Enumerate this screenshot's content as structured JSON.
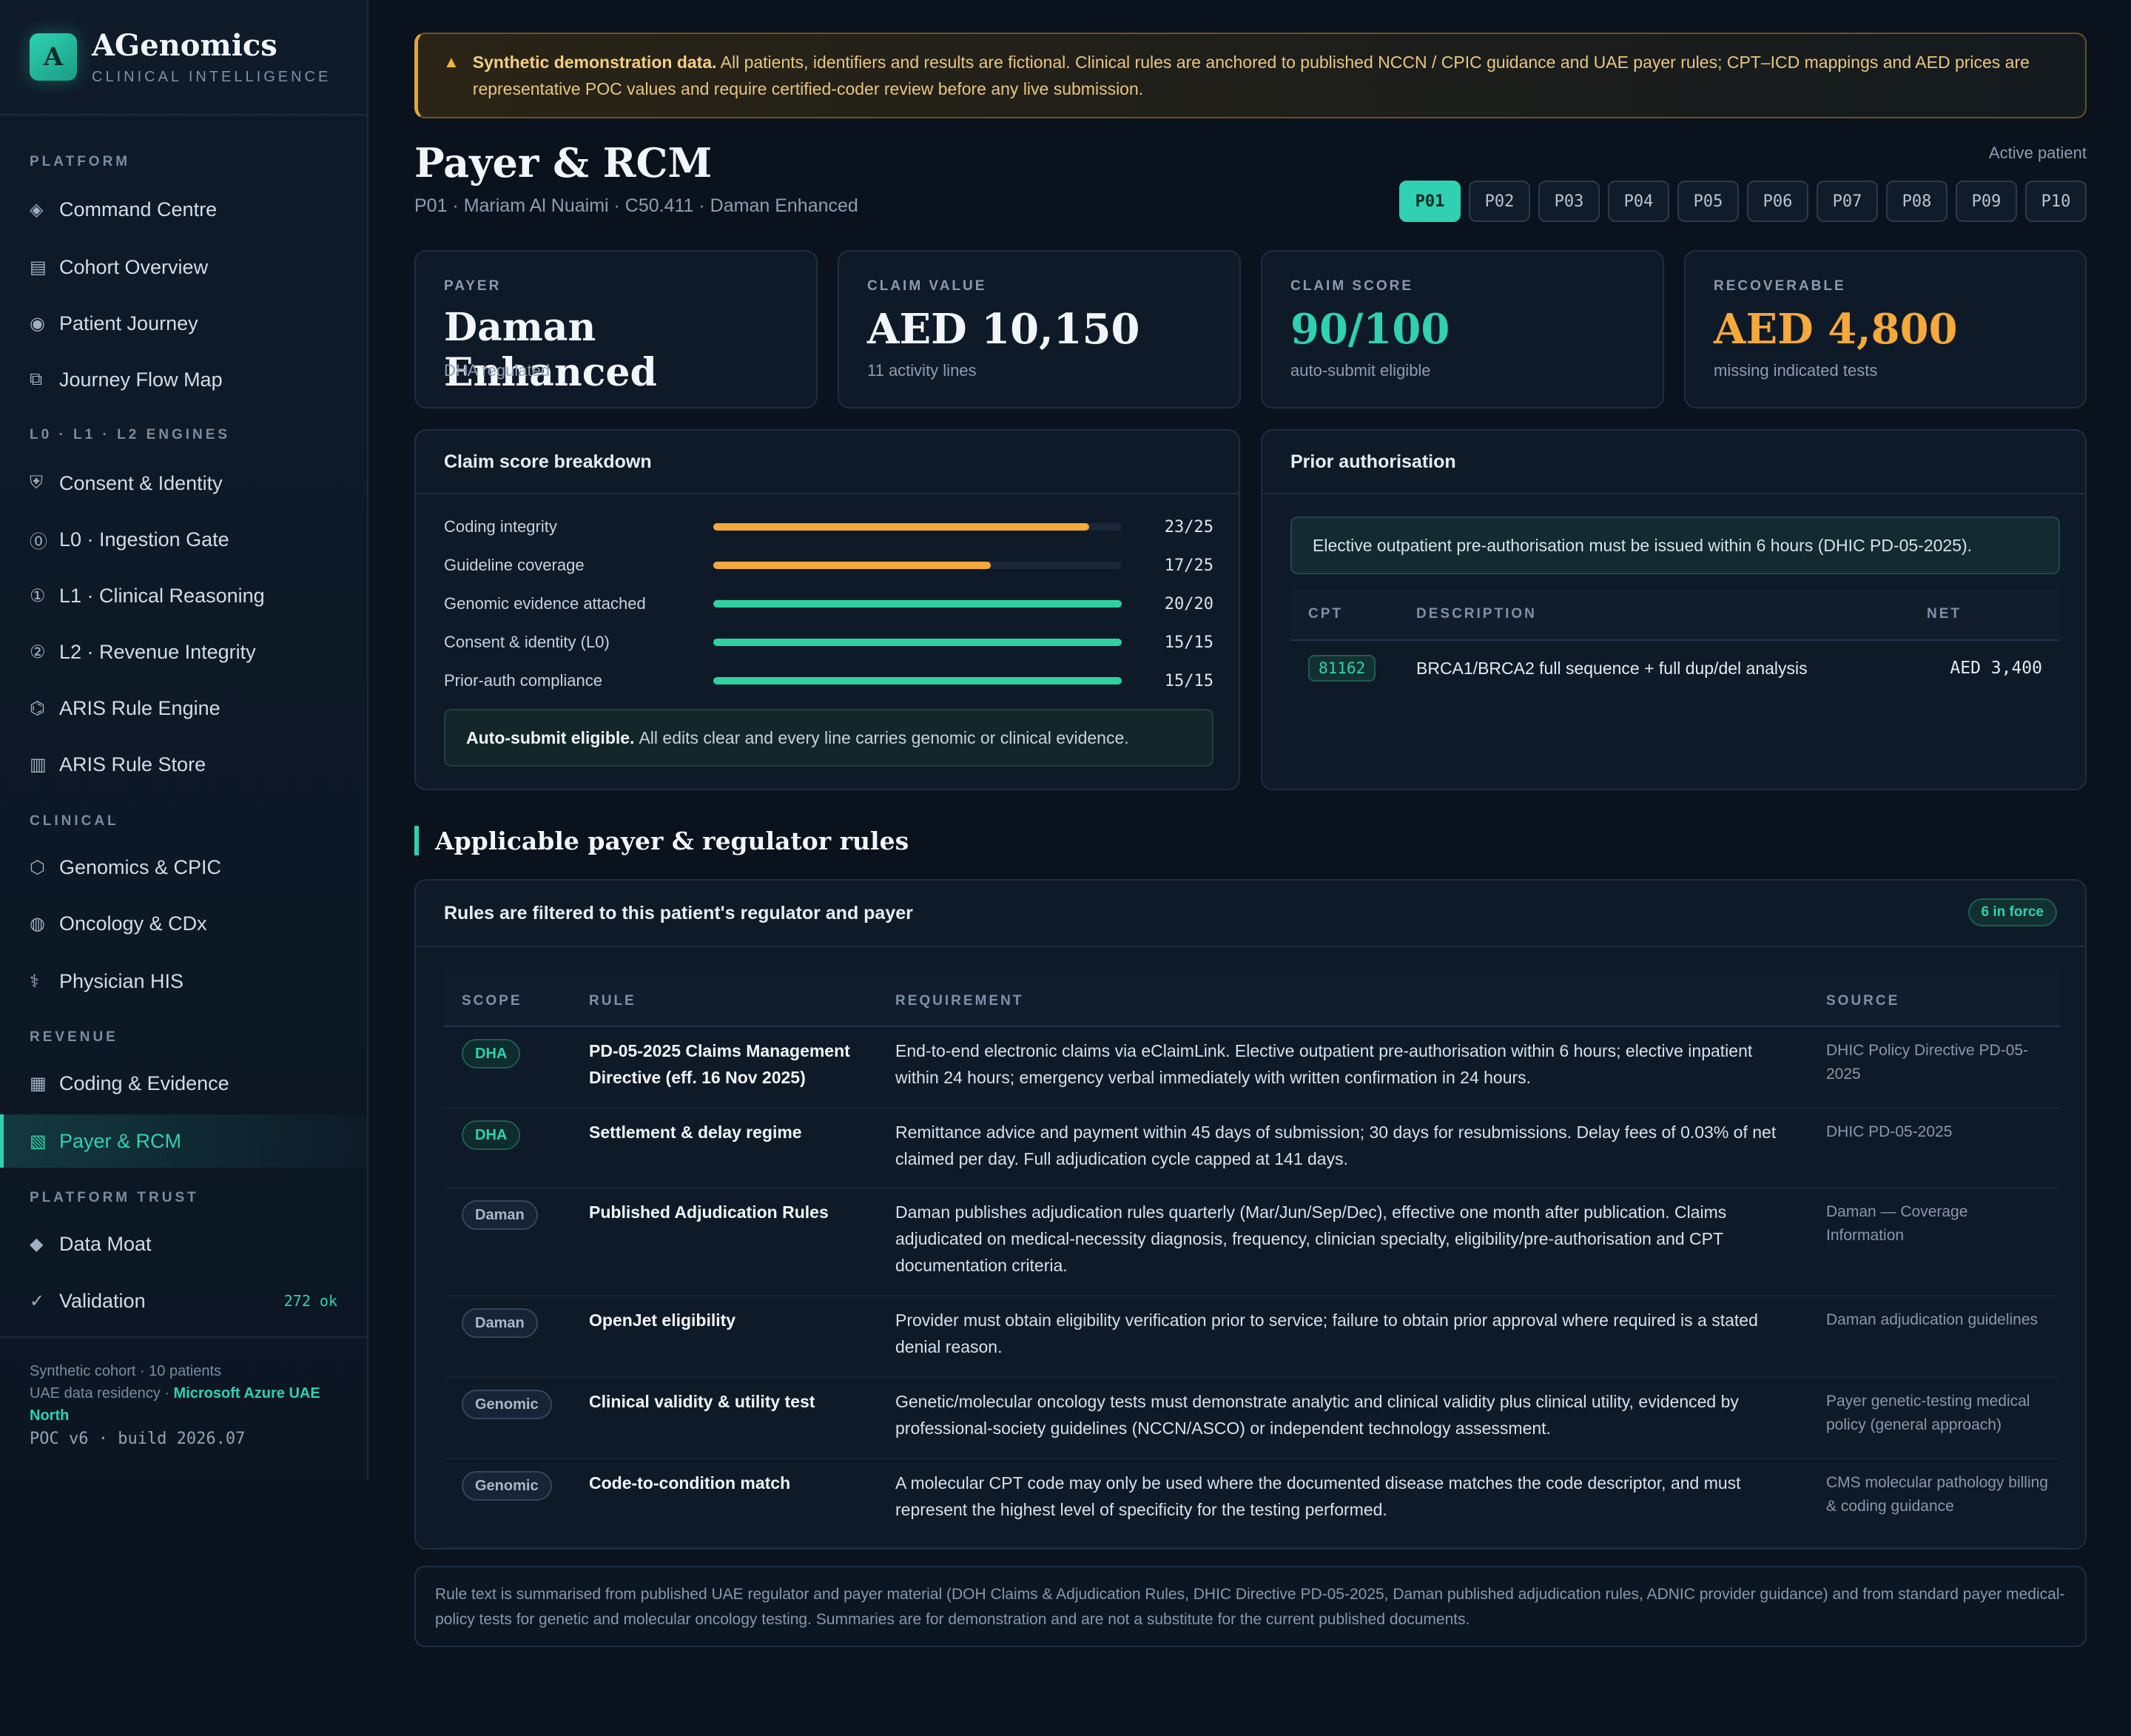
{
  "brand": {
    "logo_letter": "A",
    "name": "AGenomics",
    "subtitle": "CLINICAL INTELLIGENCE"
  },
  "sidebar": {
    "sections": {
      "platform": "PLATFORM",
      "engines": "L0 · L1 · L2 ENGINES",
      "clinical": "CLINICAL",
      "revenue": "REVENUE",
      "trust": "PLATFORM TRUST"
    },
    "items": [
      {
        "label": "Command Centre",
        "icon": "◈"
      },
      {
        "label": "Cohort Overview",
        "icon": "▤"
      },
      {
        "label": "Patient Journey",
        "icon": "◉"
      },
      {
        "label": "Journey Flow Map",
        "icon": "⧉"
      },
      {
        "label": "Consent & Identity",
        "icon": "⛨"
      },
      {
        "label": "L0 · Ingestion Gate",
        "icon": "⓪"
      },
      {
        "label": "L1 · Clinical Reasoning",
        "icon": "①"
      },
      {
        "label": "L2 · Revenue Integrity",
        "icon": "②"
      },
      {
        "label": "ARIS Rule Engine",
        "icon": "⌬"
      },
      {
        "label": "ARIS Rule Store",
        "icon": "▥"
      },
      {
        "label": "Genomics & CPIC",
        "icon": "⬡"
      },
      {
        "label": "Oncology & CDx",
        "icon": "◍"
      },
      {
        "label": "Physician HIS",
        "icon": "⚕"
      },
      {
        "label": "Coding & Evidence",
        "icon": "▦"
      },
      {
        "label": "Payer & RCM",
        "icon": "▧"
      },
      {
        "label": "Data Moat",
        "icon": "◆"
      },
      {
        "label": "Validation",
        "icon": "✓",
        "badge": "272 ok"
      }
    ],
    "footer": {
      "line1": "Synthetic cohort · 10 patients",
      "line2_prefix": "UAE data residency · ",
      "line2_highlight_a": "Microsoft Azure UAE",
      "line2_highlight_b": "North",
      "build": "POC v6 · build 2026.07"
    }
  },
  "banner": {
    "icon": "▲",
    "bold": "Synthetic demonstration data.",
    "text": "All patients, identifiers and results are fictional. Clinical rules are anchored to published NCCN / CPIC guidance and UAE payer rules; CPT–ICD mappings and AED prices are representative POC values and require certified-coder review before any live submission."
  },
  "header": {
    "title": "Payer & RCM",
    "subtitle": "P01 · Mariam Al Nuaimi · C50.411 · Daman Enhanced",
    "active_label": "Active patient",
    "patients": [
      "P01",
      "P02",
      "P03",
      "P04",
      "P05",
      "P06",
      "P07",
      "P08",
      "P09",
      "P10"
    ],
    "active_patient": "P01"
  },
  "kpis": [
    {
      "label": "PAYER",
      "value": "Daman Enhanced",
      "foot": "DHA regulated",
      "tone": "white"
    },
    {
      "label": "CLAIM VALUE",
      "value": "AED 10,150",
      "foot": "11 activity lines",
      "tone": "white"
    },
    {
      "label": "CLAIM SCORE",
      "value": "90/100",
      "foot": "auto-submit eligible",
      "tone": "green"
    },
    {
      "label": "RECOVERABLE",
      "value": "AED 4,800",
      "foot": "missing indicated tests",
      "tone": "orange"
    }
  ],
  "score_breakdown": {
    "title": "Claim score breakdown",
    "rows": [
      {
        "label": "Coding integrity",
        "score": 23,
        "max": 25,
        "text": "23/25",
        "color": "#f4a93a"
      },
      {
        "label": "Guideline coverage",
        "score": 17,
        "max": 25,
        "text": "17/25",
        "color": "#f4a93a"
      },
      {
        "label": "Genomic evidence attached",
        "score": 20,
        "max": 20,
        "text": "20/20",
        "color": "#2fd1a0"
      },
      {
        "label": "Consent & identity (L0)",
        "score": 15,
        "max": 15,
        "text": "15/15",
        "color": "#2fd1a0"
      },
      {
        "label": "Prior-auth compliance",
        "score": 15,
        "max": 15,
        "text": "15/15",
        "color": "#2fd1a0"
      }
    ],
    "note_bold": "Auto-submit eligible.",
    "note_text": "All edits clear and every line carries genomic or clinical evidence."
  },
  "prior_auth": {
    "title": "Prior authorisation",
    "note": "Elective outpatient pre-authorisation must be issued within 6 hours (DHIC PD-05-2025).",
    "columns": {
      "cpt": "CPT",
      "description": "DESCRIPTION",
      "net": "NET"
    },
    "rows": [
      {
        "cpt": "81162",
        "description": "BRCA1/BRCA2 full sequence + full dup/del analysis",
        "net": "AED 3,400"
      }
    ]
  },
  "rules": {
    "section_title": "Applicable payer & regulator rules",
    "card_title": "Rules are filtered to this patient's regulator and payer",
    "count": "6 in force",
    "columns": {
      "scope": "SCOPE",
      "rule": "RULE",
      "requirement": "REQUIREMENT",
      "source": "SOURCE"
    },
    "rows": [
      {
        "scope": "DHA",
        "tone": "teal",
        "rule": "PD-05-2025 Claims Management Directive (eff. 16 Nov 2025)",
        "requirement": "End-to-end electronic claims via eClaimLink. Elective outpatient pre-authorisation within 6 hours; elective inpatient within 24 hours; emergency verbal immediately with written confirmation in 24 hours.",
        "source": "DHIC Policy Directive PD-05-2025"
      },
      {
        "scope": "DHA",
        "tone": "teal",
        "rule": "Settlement & delay regime",
        "requirement": "Remittance advice and payment within 45 days of submission; 30 days for resubmissions. Delay fees of 0.03% of net claimed per day. Full adjudication cycle capped at 141 days.",
        "source": "DHIC PD-05-2025"
      },
      {
        "scope": "Daman",
        "tone": "grey",
        "rule": "Published Adjudication Rules",
        "requirement": "Daman publishes adjudication rules quarterly (Mar/Jun/Sep/Dec), effective one month after publication. Claims adjudicated on medical-necessity diagnosis, frequency, clinician specialty, eligibility/pre-authorisation and CPT documentation criteria.",
        "source": "Daman — Coverage Information"
      },
      {
        "scope": "Daman",
        "tone": "grey",
        "rule": "OpenJet eligibility",
        "requirement": "Provider must obtain eligibility verification prior to service; failure to obtain prior approval where required is a stated denial reason.",
        "source": "Daman adjudication guidelines"
      },
      {
        "scope": "Genomic",
        "tone": "grey",
        "rule": "Clinical validity & utility test",
        "requirement": "Genetic/molecular oncology tests must demonstrate analytic and clinical validity plus clinical utility, evidenced by professional-society guidelines (NCCN/ASCO) or independent technology assessment.",
        "source": "Payer genetic-testing medical policy (general approach)"
      },
      {
        "scope": "Genomic",
        "tone": "grey",
        "rule": "Code-to-condition match",
        "requirement": "A molecular CPT code may only be used where the documented disease matches the code descriptor, and must represent the highest level of specificity for the testing performed.",
        "source": "CMS molecular pathology billing & coding guidance"
      }
    ]
  },
  "disclaimer": "Rule text is summarised from published UAE regulator and payer material (DOH Claims & Adjudication Rules, DHIC Directive PD-05-2025, Daman published adjudication rules, ADNIC provider guidance) and from standard payer medical-policy tests for genetic and molecular oncology testing. Summaries are for demonstration and are not a substitute for the current published documents."
}
